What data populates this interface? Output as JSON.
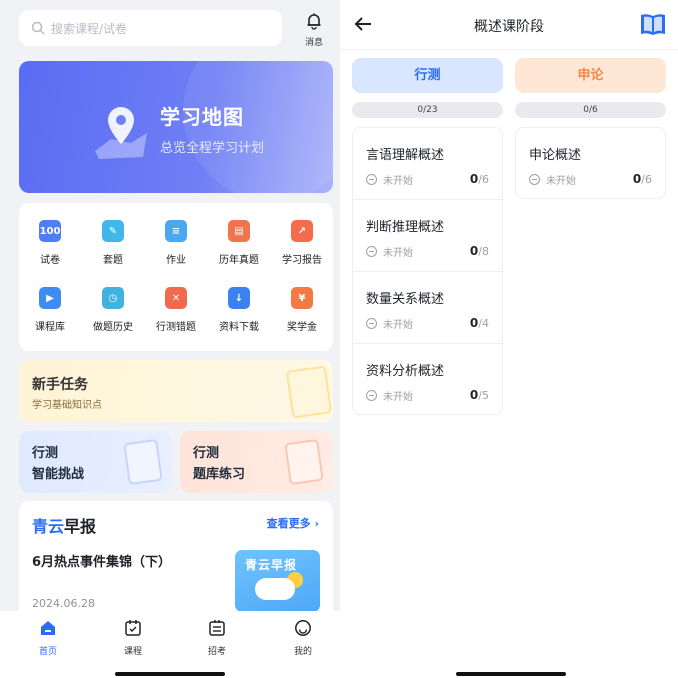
{
  "left": {
    "search": {
      "placeholder": "搜索课程/试卷"
    },
    "message_label": "消息",
    "banner": {
      "title": "学习地图",
      "subtitle": "总览全程学习计划"
    },
    "grid": [
      {
        "label": "试卷",
        "icon": "exam-paper-icon",
        "color": "#4f7cf7",
        "glyph": "100"
      },
      {
        "label": "套题",
        "icon": "question-set-icon",
        "color": "#3fb7e8",
        "glyph": "✎"
      },
      {
        "label": "作业",
        "icon": "homework-icon",
        "color": "#4aa8f0",
        "glyph": "≡"
      },
      {
        "label": "历年真题",
        "icon": "past-exams-icon",
        "color": "#f0744d",
        "glyph": "▤"
      },
      {
        "label": "学习报告",
        "icon": "study-report-icon",
        "color": "#f56b4c",
        "glyph": "↗"
      },
      {
        "label": "课程库",
        "icon": "course-library-icon",
        "color": "#3d8cf5",
        "glyph": "▶"
      },
      {
        "label": "做题历史",
        "icon": "practice-history-icon",
        "color": "#3fb2e0",
        "glyph": "◷"
      },
      {
        "label": "行测错题",
        "icon": "wrong-questions-icon",
        "color": "#f06a4e",
        "glyph": "✕"
      },
      {
        "label": "资料下载",
        "icon": "download-icon",
        "color": "#3b82f0",
        "glyph": "↓"
      },
      {
        "label": "奖学金",
        "icon": "scholarship-icon",
        "color": "#f47a45",
        "glyph": "¥"
      }
    ],
    "task": {
      "title": "新手任务",
      "subtitle": "学习基础知识点"
    },
    "card_a": {
      "line1": "行测",
      "line2": "智能挑战"
    },
    "card_b": {
      "line1": "行测",
      "line2": "题库练习"
    },
    "news": {
      "brand_a": "青云",
      "brand_b": "早报",
      "more": "查看更多",
      "headline": "6月热点事件集锦（下）",
      "date": "2024.06.28",
      "thumb_text": "青云早报"
    },
    "tabs": [
      {
        "label": "首页",
        "icon": "home-icon",
        "active": true
      },
      {
        "label": "课程",
        "icon": "calendar-icon",
        "active": false
      },
      {
        "label": "招考",
        "icon": "recruit-icon",
        "active": false
      },
      {
        "label": "我的",
        "icon": "profile-icon",
        "active": false
      }
    ]
  },
  "right": {
    "title": "概述课阶段",
    "segments": [
      {
        "label": "行测",
        "progress": "0/23"
      },
      {
        "label": "申论",
        "progress": "0/6"
      }
    ],
    "list_a": [
      {
        "name": "言语理解概述",
        "status": "未开始",
        "done": "0",
        "total": "/6"
      },
      {
        "name": "判断推理概述",
        "status": "未开始",
        "done": "0",
        "total": "/8"
      },
      {
        "name": "数量关系概述",
        "status": "未开始",
        "done": "0",
        "total": "/4"
      },
      {
        "name": "资料分析概述",
        "status": "未开始",
        "done": "0",
        "total": "/5"
      }
    ],
    "list_b": [
      {
        "name": "申论概述",
        "status": "未开始",
        "done": "0",
        "total": "/6"
      }
    ]
  }
}
